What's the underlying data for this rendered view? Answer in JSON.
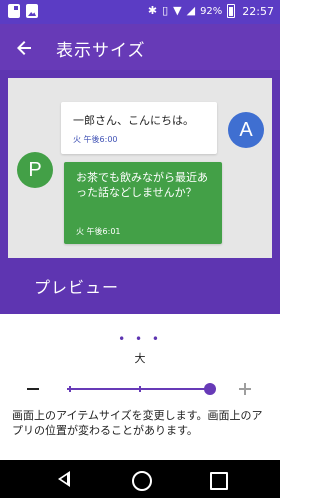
{
  "status_bar": {
    "battery": "92%",
    "time": "22:57",
    "icons": [
      "document-icon",
      "image-icon",
      "bluetooth-icon",
      "vibrate-icon",
      "wifi-icon",
      "signal-icon",
      "battery-icon"
    ]
  },
  "app_bar": {
    "title": "表示サイズ",
    "back_icon": "arrow-left-icon"
  },
  "preview": {
    "messages": [
      {
        "avatar": "A",
        "text": "一郎さん、こんにちは。",
        "time": "火 午後6:00"
      },
      {
        "avatar": "P",
        "text": "お茶でも飲みながら最近あった話などしませんか？",
        "time": "火 午後6:01"
      }
    ],
    "label": "プレビュー"
  },
  "size_control": {
    "dots": "• • •",
    "current_size": "大",
    "slider_value": 1.0,
    "slider_steps": 3
  },
  "description": "画面上のアイテムサイズを変更します。画面上のアプリの位置が変わることがあります。",
  "colors": {
    "status_bar": "#5b3cc4",
    "app_bar": "#673ab7",
    "preview_bg": "#5e35b1",
    "avatar_a": "#3f6fd1",
    "avatar_p": "#43a047",
    "accent": "#673ab7"
  }
}
